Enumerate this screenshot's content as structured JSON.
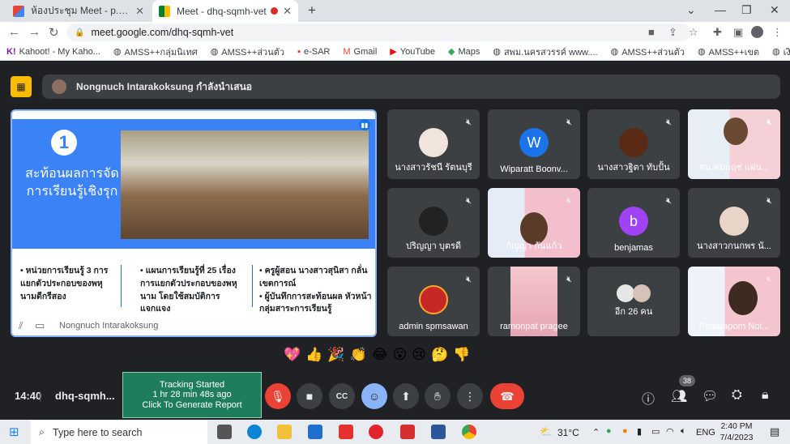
{
  "browser": {
    "tabs": [
      {
        "title": "ห้องประชุม Meet - p.noigor@gmail.c",
        "active": false
      },
      {
        "title": "Meet - dhq-sqmh-vet",
        "active": true
      }
    ],
    "url": "meet.google.com/dhq-sqmh-vet",
    "bookmarks": [
      "Kahoot! - My Kaho...",
      "AMSS++กลุ่มนิเทศ",
      "AMSS++ส่วนตัว",
      "e-SAR",
      "Gmail",
      "YouTube",
      "Maps",
      "สพม.นครสวรรค์ www....",
      "AMSS++ส่วนตัว",
      "AMSS++เขต",
      "เงินเดือน"
    ]
  },
  "meet": {
    "presenter_label": "Nongnuch Intarakoksung กำลังนำเสนอ",
    "slide": {
      "number": "1",
      "title_line1": "สะท้อนผลการจัด",
      "title_line2": "การเรียนรู้เชิงรุก",
      "col1": "• หน่วยการเรียนรู้ 3 การแยกตัวประกอบของพหุนามดีกรีสอง",
      "col2": "• แผนการเรียนรู้ที่ 25 เรื่อง การแยกตัวประกอบของพหุนาม โดยใช้สมบัติการแจกแจง",
      "col3a": "• ครูผู้สอน นางสาวสุนิสา กลั่นเขตการณ์",
      "col3b": "• ผู้บันทึกการสะท้อนผล หัวหน้ากลุ่มสาระการเรียนรู้"
    },
    "stage_name": "Nongnuch Intarakoksung",
    "participants": [
      {
        "name": "นางสาวรัชนี รัตนบุรี",
        "kind": "photo"
      },
      {
        "name": "Wiparatt Boonv...",
        "kind": "letter",
        "letter": "W",
        "color": "#1a73e8"
      },
      {
        "name": "นางสาวฐิตา ทับปั้น",
        "kind": "photo"
      },
      {
        "name": "ศน.คมกฤช แผ่น...",
        "kind": "video"
      },
      {
        "name": "ปริญญา บุตรดี",
        "kind": "photo"
      },
      {
        "name": "กัญญา กันแก้ว",
        "kind": "video"
      },
      {
        "name": "benjamas",
        "kind": "letter",
        "letter": "b",
        "color": "#a142f4"
      },
      {
        "name": "นางสาวกนกพร นั...",
        "kind": "photo"
      },
      {
        "name": "admin spmsawan",
        "kind": "photo"
      },
      {
        "name": "ramonpat pragee",
        "kind": "video"
      },
      {
        "name": "อีก 26 คน",
        "kind": "others"
      },
      {
        "name": "Pattaraporn Noi...",
        "kind": "video"
      }
    ],
    "reactions": [
      "💖",
      "👍",
      "🎉",
      "👏",
      "😂",
      "😮",
      "😢",
      "🤔",
      "👎"
    ],
    "time": "14:40",
    "meeting_code": "dhq-sqmh...",
    "tracking": {
      "line1": "Tracking Started",
      "line2": "1 hr 28 min 48s ago",
      "line3": "Click To Generate Report"
    },
    "people_count": "38"
  },
  "taskbar": {
    "search_placeholder": "Type here to search",
    "weather": "31°C",
    "lang": "ENG",
    "clock_time": "2:40 PM",
    "clock_date": "7/4/2023"
  }
}
